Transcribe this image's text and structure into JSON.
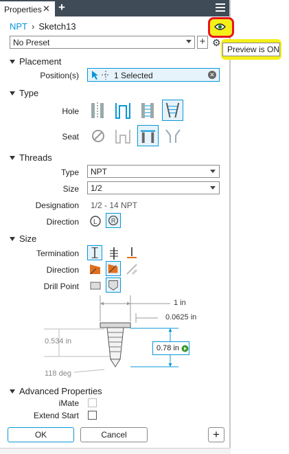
{
  "tab": {
    "label": "Properties"
  },
  "breadcrumb": {
    "root": "NPT",
    "current": "Sketch13"
  },
  "preset": {
    "value": "No Preset"
  },
  "tooltip": {
    "text": "Preview is ON"
  },
  "sections": {
    "placement": "Placement",
    "type": "Type",
    "threads": "Threads",
    "size": "Size",
    "advanced": "Advanced Properties"
  },
  "placement": {
    "positions_label": "Position(s)",
    "positions_value": "1 Selected"
  },
  "type": {
    "hole_label": "Hole",
    "seat_label": "Seat"
  },
  "threads": {
    "type_label": "Type",
    "type_value": "NPT",
    "size_label": "Size",
    "size_value": "1/2",
    "designation_label": "Designation",
    "designation_value": "1/2 - 14 NPT",
    "direction_label": "Direction"
  },
  "size": {
    "termination_label": "Termination",
    "direction_label": "Direction",
    "drill_point_label": "Drill Point"
  },
  "diagram": {
    "dim_top": "1 in",
    "dim_chamfer": "0.0625 in",
    "dim_left": "0.534 in",
    "dim_depth": "0.78 in",
    "dim_angle": "118 deg"
  },
  "advanced": {
    "imate_label": "iMate",
    "extend_start_label": "Extend Start"
  },
  "buttons": {
    "ok": "OK",
    "cancel": "Cancel"
  },
  "colors": {
    "accent": "#0696d7",
    "highlight": "#f5ef1a",
    "annotation_red": "#e8141c",
    "tabbar": "#3f4b57"
  }
}
